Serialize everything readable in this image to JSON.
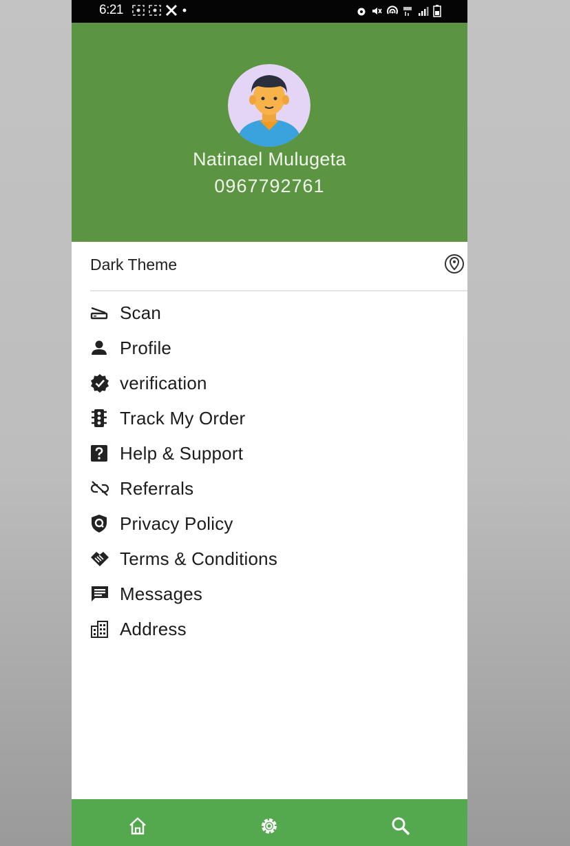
{
  "status_bar": {
    "time": "6:21",
    "left_icons": [
      "screenshot-icon",
      "screenshot-icon",
      "x-logo-icon",
      "dot-icon"
    ],
    "right_icons": [
      "alarm-icon",
      "mute-icon",
      "hotspot-icon",
      "lte-icon",
      "signal-icon",
      "battery-icon"
    ]
  },
  "header": {
    "background": "#5b9541",
    "name": "Natinael Mulugeta",
    "phone": "0967792761"
  },
  "theme": {
    "label": "Dark Theme",
    "enabled": false
  },
  "menu": [
    {
      "label": "Scan",
      "icon": "scanner-icon"
    },
    {
      "label": "Profile",
      "icon": "person-icon"
    },
    {
      "label": "verification",
      "icon": "verified-icon"
    },
    {
      "label": "Track My Order",
      "icon": "traffic-light-icon"
    },
    {
      "label": "Help & Support",
      "icon": "help-icon"
    },
    {
      "label": "Referrals",
      "icon": "link-off-icon"
    },
    {
      "label": "Privacy Policy",
      "icon": "privacy-shield-icon"
    },
    {
      "label": "Terms & Conditions",
      "icon": "handshake-icon"
    },
    {
      "label": "Messages",
      "icon": "message-icon"
    },
    {
      "label": "Address",
      "icon": "buildings-icon"
    }
  ],
  "bottom_nav": {
    "background": "#54a84e",
    "items": [
      "home-icon",
      "settings-icon",
      "search-icon"
    ]
  }
}
